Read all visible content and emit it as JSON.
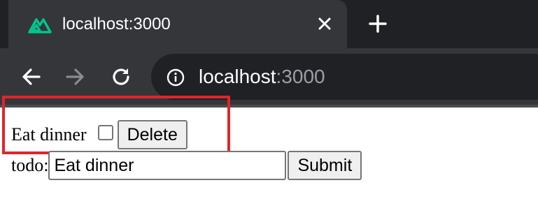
{
  "browser": {
    "tab_title": "localhost:3000",
    "favicon": "nuxt-logo-icon",
    "close_icon": "close-icon",
    "new_tab_icon": "plus-icon",
    "url_host": "localhost",
    "url_port": ":3000",
    "colors": {
      "tabstrip": "#202124",
      "toolbar": "#35363a",
      "favicon": "#00c58e"
    }
  },
  "page": {
    "todos": [
      {
        "text": "Eat dinner",
        "checked": false,
        "delete_label": "Delete"
      }
    ],
    "form": {
      "label": "todo:",
      "input_value": "Eat dinner",
      "submit_label": "Submit"
    },
    "highlight_color": "#e0252b"
  }
}
